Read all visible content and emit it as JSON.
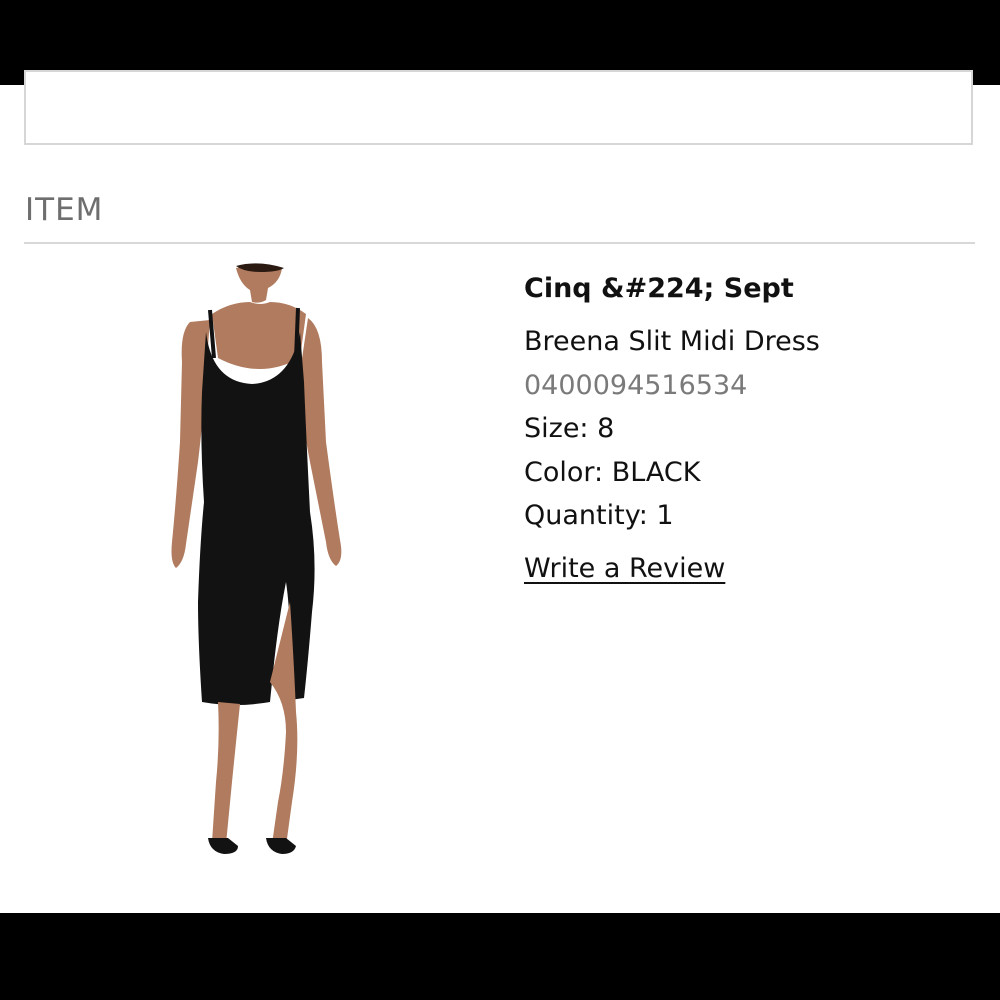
{
  "section": {
    "title": "ITEM"
  },
  "item": {
    "brand": "Cinq &#224; Sept",
    "name": "Breena Slit Midi Dress",
    "sku": "0400094516534",
    "size": "Size: 8",
    "color": "Color: BLACK",
    "quantity": "Quantity: 1",
    "review_link": "Write a Review",
    "image_alt": "Black sleeveless midi dress with side slit worn by model"
  },
  "colors": {
    "text": "#111111",
    "muted": "#7a7a7a",
    "divider": "#d8d8d8",
    "dress": "#121212",
    "skin": "#b07b5e"
  }
}
